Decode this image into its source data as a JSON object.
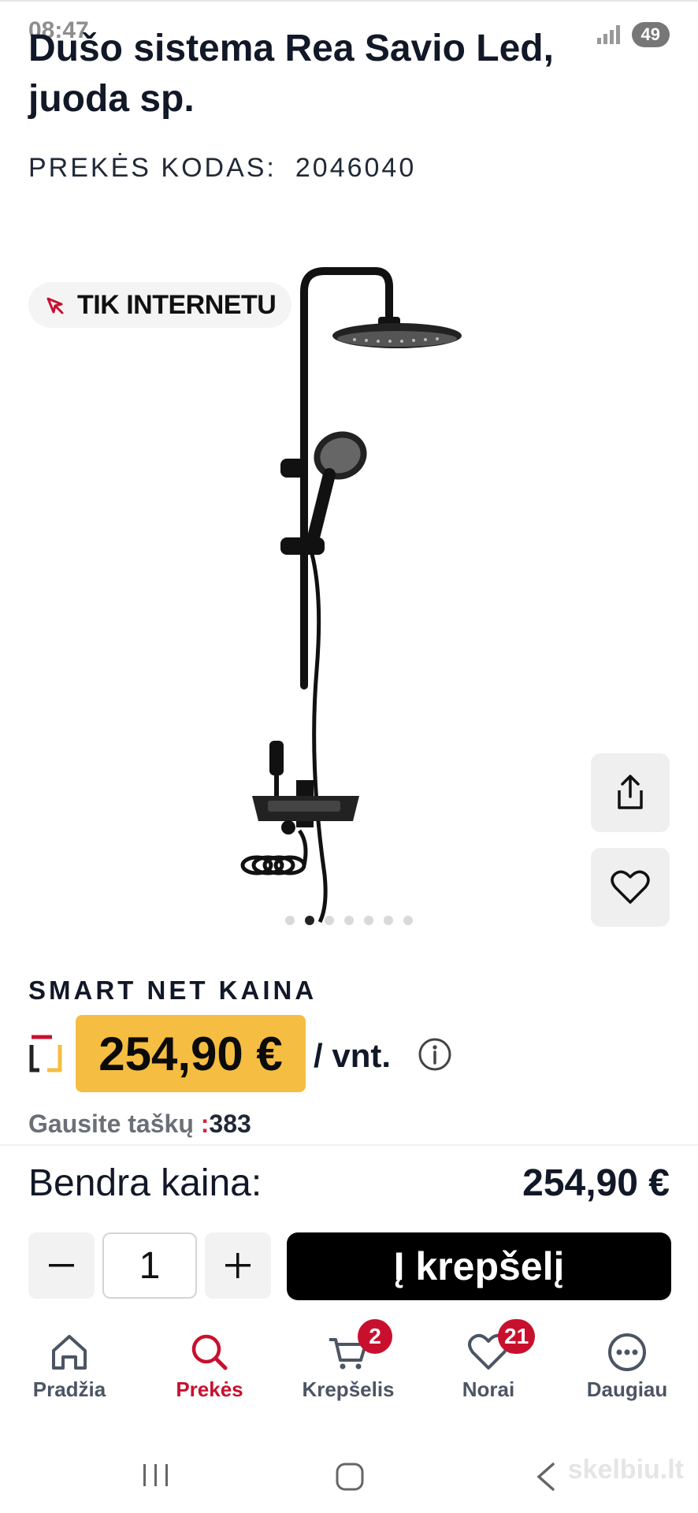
{
  "status_bar": {
    "time": "08:47",
    "battery": "49"
  },
  "product": {
    "title": "Dušo sistema Rea Savio Led, juoda sp.",
    "code_label": "PREKĖS KODAS:",
    "code_value": "2046040",
    "badge": "TIK INTERNETU",
    "image_icon": "shower-system-image",
    "gallery_count": 7,
    "gallery_active_index": 1
  },
  "actions": {
    "share_icon": "share-icon",
    "favorite_icon": "heart-icon"
  },
  "pricing": {
    "label": "SMART NET KAINA",
    "price": "254,90 €",
    "unit": "/ vnt.",
    "points_label": "Gausite taškų ",
    "points_colon": ":",
    "points_value": "383",
    "price_bg": "#f5bd41"
  },
  "total": {
    "label": "Bendra kaina:",
    "value": "254,90 €"
  },
  "quantity": {
    "minus": "−",
    "value": "1",
    "plus": "+"
  },
  "cart_button": {
    "label": "Į krepšelį"
  },
  "bottom_nav": {
    "items": [
      {
        "label": "Pradžia",
        "icon": "home-icon"
      },
      {
        "label": "Prekės",
        "icon": "search-icon",
        "active": true
      },
      {
        "label": "Krepšelis",
        "icon": "cart-icon",
        "badge": "2"
      },
      {
        "label": "Norai",
        "icon": "heart-icon",
        "badge": "21"
      },
      {
        "label": "Daugiau",
        "icon": "more-icon"
      }
    ]
  },
  "watermark": "skelbiu.lt",
  "colors": {
    "accent": "#c8102e",
    "text": "#111827"
  }
}
